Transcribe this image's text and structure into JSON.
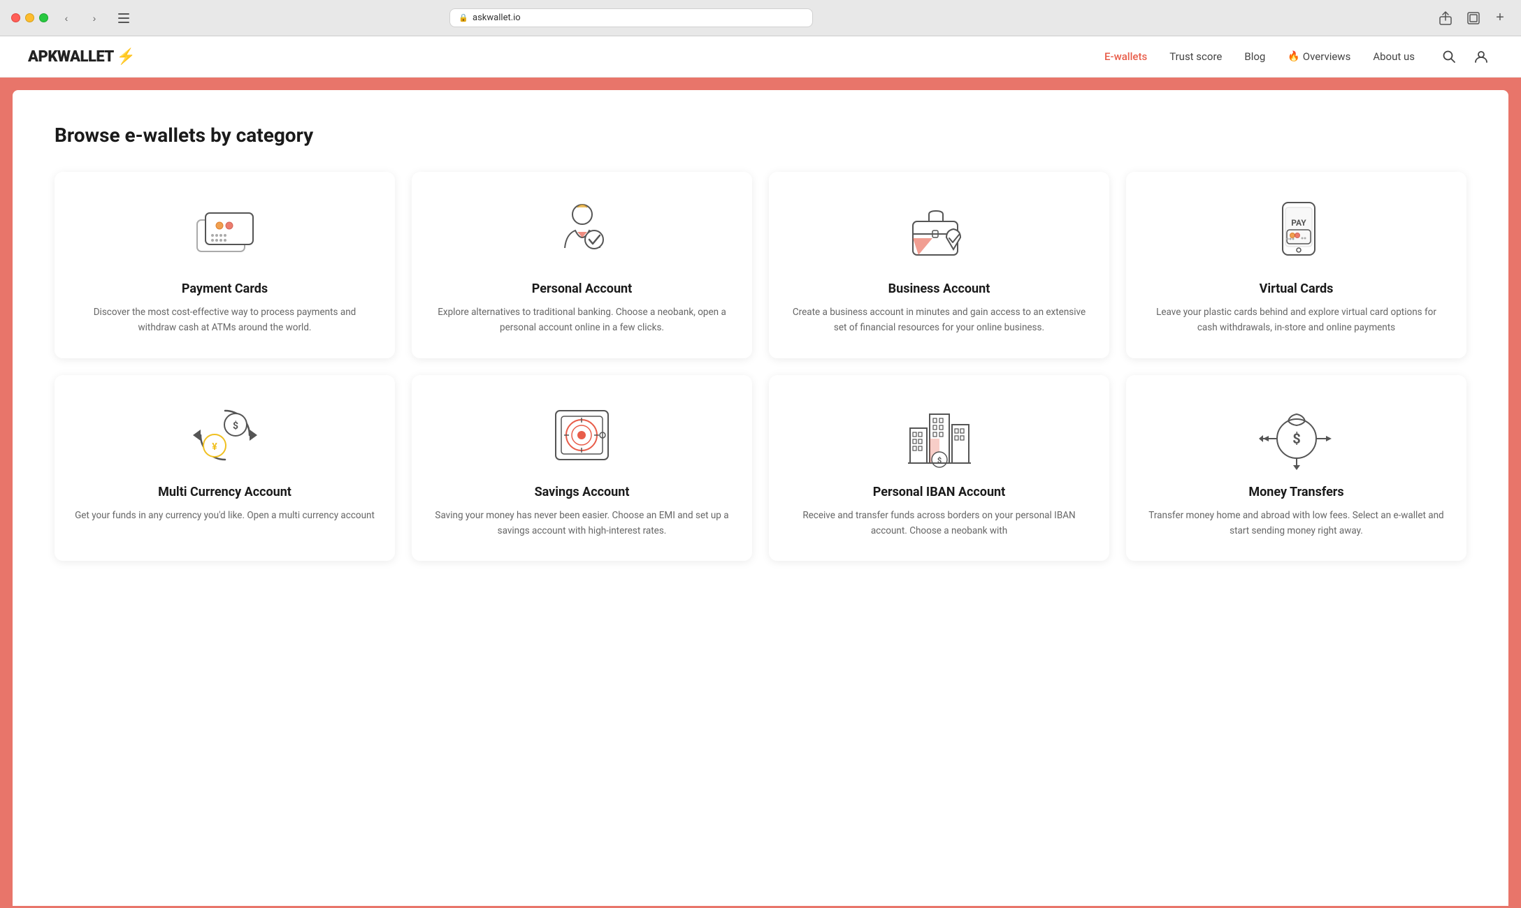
{
  "browser": {
    "url": "askwallet.io",
    "traffic_lights": [
      "red",
      "yellow",
      "green"
    ]
  },
  "nav": {
    "logo_text": "APKWALLET",
    "logo_suffix": "⚡",
    "links": [
      {
        "id": "ewallets",
        "label": "E-wallets",
        "active": true
      },
      {
        "id": "trust-score",
        "label": "Trust score",
        "active": false
      },
      {
        "id": "blog",
        "label": "Blog",
        "active": false
      },
      {
        "id": "overviews",
        "label": "Overviews",
        "active": false,
        "has_fire": true
      },
      {
        "id": "about-us",
        "label": "About us",
        "active": false
      }
    ]
  },
  "main": {
    "title": "Browse e-wallets by category",
    "cards_row1": [
      {
        "id": "payment-cards",
        "title": "Payment Cards",
        "description": "Discover the most cost-effective way to process payments and withdraw cash at ATMs around the world."
      },
      {
        "id": "personal-account",
        "title": "Personal Account",
        "description": "Explore alternatives to traditional banking. Choose a neobank, open a personal account online in a few clicks."
      },
      {
        "id": "business-account",
        "title": "Business Account",
        "description": "Create a business account in minutes and gain access to an extensive set of financial resources for your online business."
      },
      {
        "id": "virtual-cards",
        "title": "Virtual Cards",
        "description": "Leave your plastic cards behind and explore virtual card options for cash withdrawals, in-store and online payments"
      }
    ],
    "cards_row2": [
      {
        "id": "multi-currency",
        "title": "Multi Currency Account",
        "description": "Get your funds in any currency you'd like. Open a multi currency account"
      },
      {
        "id": "savings-account",
        "title": "Savings Account",
        "description": "Saving your money has never been easier. Choose an EMI and set up a savings account with high-interest rates."
      },
      {
        "id": "personal-iban",
        "title": "Personal IBAN Account",
        "description": "Receive and transfer funds across borders on your personal IBAN account. Choose a neobank with"
      },
      {
        "id": "money-transfers",
        "title": "Money Transfers",
        "description": "Transfer money home and abroad with low fees. Select an e-wallet and start sending money right away."
      }
    ]
  }
}
